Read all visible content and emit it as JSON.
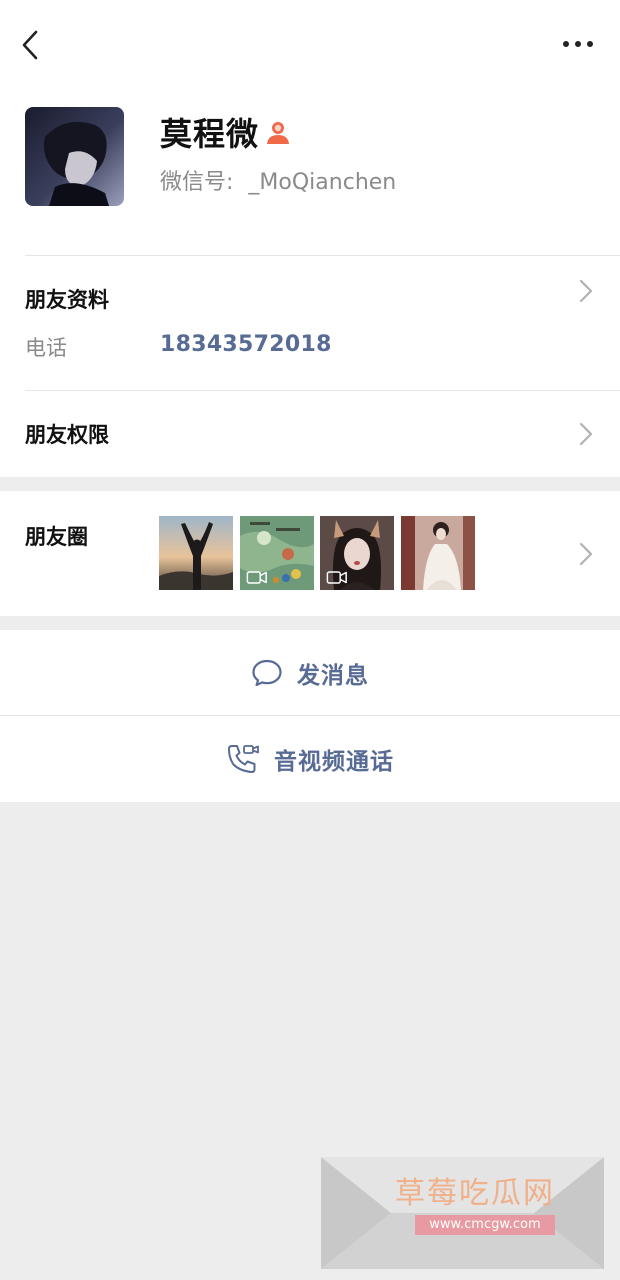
{
  "profile": {
    "name": "莫程微",
    "wechat_id_label": "微信号:",
    "wechat_id": "_MoQianchen",
    "gender_icon": "person-female-icon"
  },
  "friend_info": {
    "title": "朋友资料",
    "phone_label": "电话",
    "phone_value": "18343572018"
  },
  "permissions": {
    "title": "朋友权限"
  },
  "moments": {
    "title": "朋友圈",
    "thumbnails": [
      {
        "name": "silhouette-sunset",
        "video": false
      },
      {
        "name": "game-screenshot",
        "video": true
      },
      {
        "name": "girl-cat-ears",
        "video": true
      },
      {
        "name": "white-dress",
        "video": false
      }
    ]
  },
  "actions": {
    "message_label": "发消息",
    "call_label": "音视频通话"
  },
  "watermark": {
    "title": "草莓吃瓜网",
    "url": "www.cmcgw.com"
  },
  "colors": {
    "accent": "#576b95",
    "background": "#ededed",
    "card": "#ffffff",
    "secondary_text": "#8a8a8a"
  }
}
